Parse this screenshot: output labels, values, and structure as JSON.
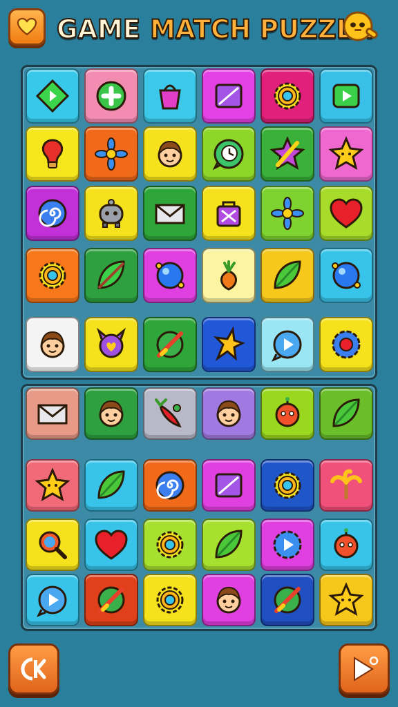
{
  "title": {
    "word1": "GAME",
    "word2": "MATCH PUZZLA"
  },
  "header": {
    "heart_icon": "heart-icon",
    "mascot_icon": "mascot-icon"
  },
  "bottom": {
    "left_icon": "restart-icon",
    "right_icon": "play-icon"
  },
  "colors": {
    "background": "#2a7f9c",
    "button": "#f07d12"
  },
  "board_top": [
    [
      "diamond",
      "plus-circle",
      "bag",
      "card",
      "gear",
      "play-square"
    ],
    [
      "bulb",
      "flower",
      "face",
      "chat-clock",
      "star-cross",
      "star"
    ],
    [
      "spiral",
      "robot",
      "envelope",
      "lock-box",
      "flower",
      "heart"
    ],
    [
      "gear",
      "leaf-slash",
      "orb",
      "fruit",
      "leaf",
      "orb"
    ],
    [
      "face",
      "horn-heart",
      "leaf-cross",
      "fire-star",
      "play-bubble",
      "gear-heart"
    ]
  ],
  "board_bottom": [
    [
      "envelope",
      "face",
      "chili",
      "face",
      "critter",
      "leaf"
    ],
    [
      "star",
      "leaf",
      "spiral",
      "card",
      "gear",
      "palm"
    ],
    [
      "magnifier",
      "heart",
      "gear",
      "leaf",
      "play-gear",
      "critter"
    ],
    [
      "play-bubble",
      "leaf-cross",
      "gear",
      "face",
      "leaf-cross",
      "star"
    ]
  ],
  "tile_colors_top": [
    [
      "#38c8ea",
      "#f28cb0",
      "#3cc8e8",
      "#e340e6",
      "#e0207a",
      "#38c0e8"
    ],
    [
      "#f6e61c",
      "#f06a1a",
      "#f6e21c",
      "#8ed62a",
      "#3bb03a",
      "#ee68d0"
    ],
    [
      "#c230d8",
      "#f6e21c",
      "#2fa63a",
      "#f6e21c",
      "#7ed330",
      "#a8dc2a"
    ],
    [
      "#f6781a",
      "#2ea040",
      "#e040e0",
      "#fcf4a0",
      "#f6c81c",
      "#38c4ea"
    ],
    [
      "#f4f4f4",
      "#f6e21c",
      "#2fa63a",
      "#2058d8",
      "#9ae6f4",
      "#f6e21c"
    ]
  ],
  "tile_colors_bottom": [
    [
      "#e89a88",
      "#2ea040",
      "#b8b8c8",
      "#a07ae0",
      "#9ad820",
      "#6abe2a"
    ],
    [
      "#f06a78",
      "#38c4ea",
      "#f06a1a",
      "#e040e0",
      "#1f56c8",
      "#f0507a"
    ],
    [
      "#f6e21c",
      "#38c4ea",
      "#a8e030",
      "#a8e030",
      "#e040e0",
      "#38c4ea"
    ],
    [
      "#38c4ea",
      "#e0401a",
      "#f6e21c",
      "#e040e0",
      "#1f4fc0",
      "#f6c81c"
    ]
  ]
}
